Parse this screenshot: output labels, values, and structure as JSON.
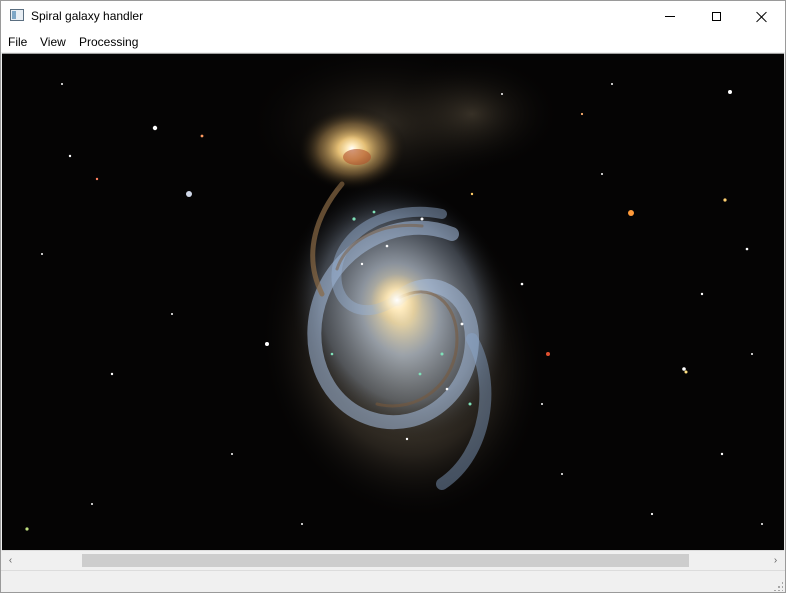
{
  "window": {
    "title": "Spiral galaxy handler",
    "icon": "app-window-icon",
    "controls": {
      "minimize": "minimize-icon",
      "maximize": "maximize-icon",
      "close": "close-icon"
    }
  },
  "menu": {
    "items": [
      {
        "label": "File"
      },
      {
        "label": "View"
      },
      {
        "label": "Processing"
      }
    ]
  },
  "scrollbar": {
    "left_arrow": "‹",
    "right_arrow": "›"
  },
  "image": {
    "subject": "spiral-galaxy-image"
  }
}
